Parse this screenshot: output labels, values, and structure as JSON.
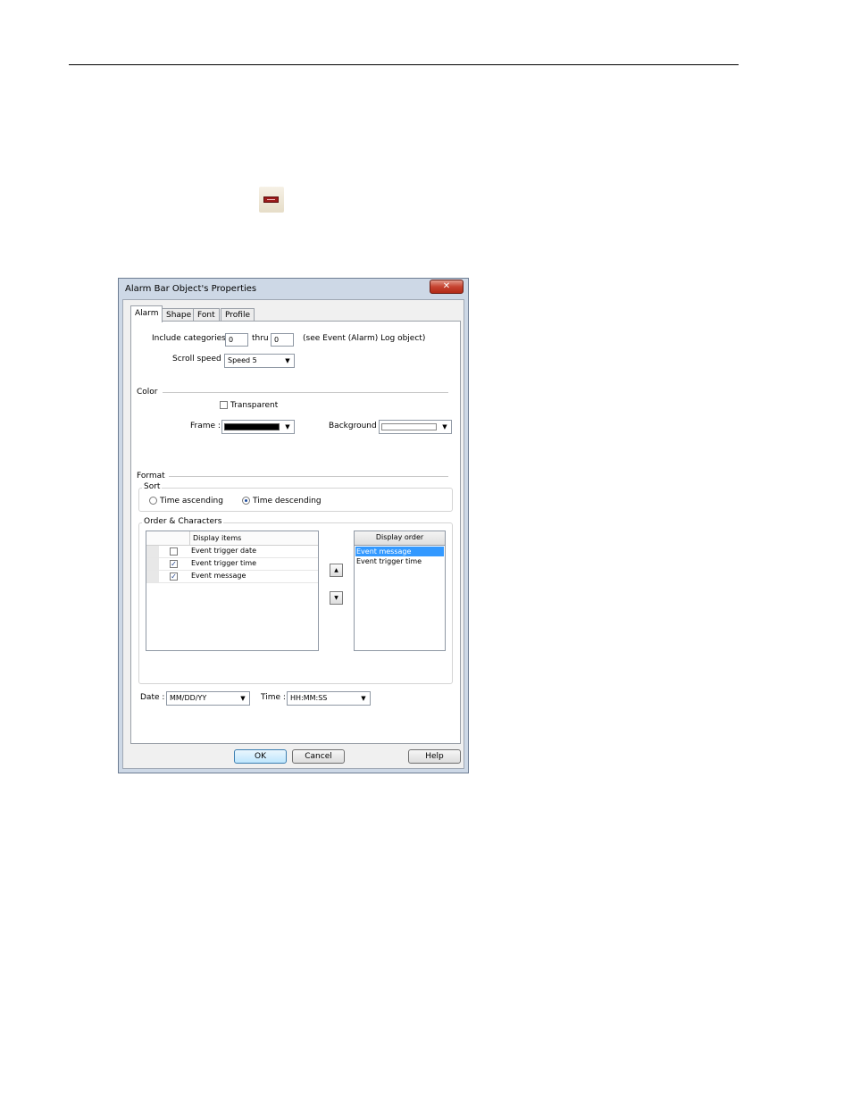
{
  "dialog": {
    "title": "Alarm Bar Object's Properties",
    "close_glyph": "✕",
    "tabs": [
      {
        "label": "Alarm",
        "active": true
      },
      {
        "label": "Shape",
        "active": false
      },
      {
        "label": "Font",
        "active": false
      },
      {
        "label": "Profile",
        "active": false
      }
    ],
    "include_categories": {
      "label": "Include categories :",
      "from": "0",
      "thru_label": "thru",
      "to": "0",
      "note": "(see Event (Alarm) Log object)"
    },
    "scroll_speed": {
      "label": "Scroll speed :",
      "value": "Speed 5"
    },
    "color": {
      "section_label": "Color",
      "transparent_label": "Transparent",
      "transparent_checked": false,
      "frame_label": "Frame :",
      "frame_color": "#000000",
      "background_label": "Background :",
      "background_color": "#ffffff"
    },
    "format": {
      "section_label": "Format",
      "sort_label": "Sort",
      "time_ascending_label": "Time ascending",
      "time_descending_label": "Time descending",
      "selected": "time_descending"
    },
    "order": {
      "group_label": "Order & Characters",
      "display_items_header": "Display items",
      "display_items": [
        {
          "label": "Event trigger date",
          "checked": false
        },
        {
          "label": "Event trigger time",
          "checked": true
        },
        {
          "label": "Event message",
          "checked": true
        }
      ],
      "move_up_glyph": "▲",
      "move_down_glyph": "▼",
      "display_order_header": "Display order",
      "display_order": [
        {
          "label": "Event message",
          "selected": true
        },
        {
          "label": "Event trigger time",
          "selected": false
        }
      ]
    },
    "date": {
      "label": "Date :",
      "value": "MM/DD/YY"
    },
    "time": {
      "label": "Time :",
      "value": "HH:MM:SS"
    },
    "buttons": {
      "ok": "OK",
      "cancel": "Cancel",
      "help": "Help"
    },
    "combo_arrow": "▼",
    "check_glyph": "✓"
  }
}
